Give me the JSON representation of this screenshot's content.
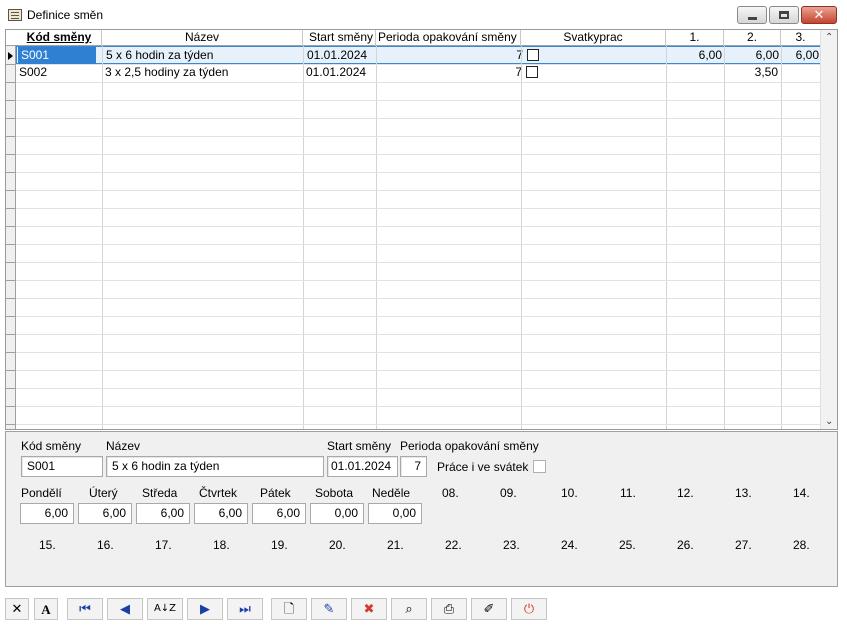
{
  "window": {
    "title": "Definice směn",
    "icon": "schedule-form-icon"
  },
  "grid": {
    "columns": {
      "code": "Kód směny",
      "name": "Název",
      "start": "Start směny",
      "period": "Perioda opakování směny",
      "holiday": "Svatkyprac",
      "d1": "1.",
      "d2": "2.",
      "d3": "3."
    },
    "rows": [
      {
        "code": "S001",
        "name": "5 x 6 hodin za týden",
        "start": "01.01.2024",
        "period": "7",
        "d1": "6,00",
        "d2": "6,00",
        "d3": "6,00"
      },
      {
        "code": "S002",
        "name": "3 x 2,5 hodiny za týden",
        "start": "01.01.2024",
        "period": "7",
        "d1": "",
        "d2": "3,50",
        "d3": ""
      }
    ]
  },
  "detail": {
    "labels": {
      "code": "Kód směny",
      "name": "Název",
      "start": "Start směny",
      "period": "Perioda opakování směny",
      "holiday": "Práce i ve svátek"
    },
    "values": {
      "code": "S001",
      "name": "5 x 6 hodin za týden",
      "start": "01.01.2024",
      "period": "7"
    },
    "days": [
      {
        "label": "Pondělí",
        "value": "6,00"
      },
      {
        "label": "Úterý",
        "value": "6,00"
      },
      {
        "label": "Středa",
        "value": "6,00"
      },
      {
        "label": "Čtvrtek",
        "value": "6,00"
      },
      {
        "label": "Pátek",
        "value": "6,00"
      },
      {
        "label": "Sobota",
        "value": "0,00"
      },
      {
        "label": "Neděle",
        "value": "0,00"
      }
    ],
    "day_numbers_row1": [
      "08.",
      "09.",
      "10.",
      "11.",
      "12.",
      "13.",
      "14."
    ],
    "day_numbers_row2": [
      "15.",
      "16.",
      "17.",
      "18.",
      "19.",
      "20.",
      "21.",
      "22.",
      "23.",
      "24.",
      "25.",
      "26.",
      "27.",
      "28."
    ]
  },
  "toolbar": {
    "buttons": [
      "close",
      "font",
      "first",
      "previous",
      "sort",
      "next",
      "last",
      "new",
      "edit",
      "delete",
      "find",
      "print",
      "export",
      "power"
    ]
  }
}
